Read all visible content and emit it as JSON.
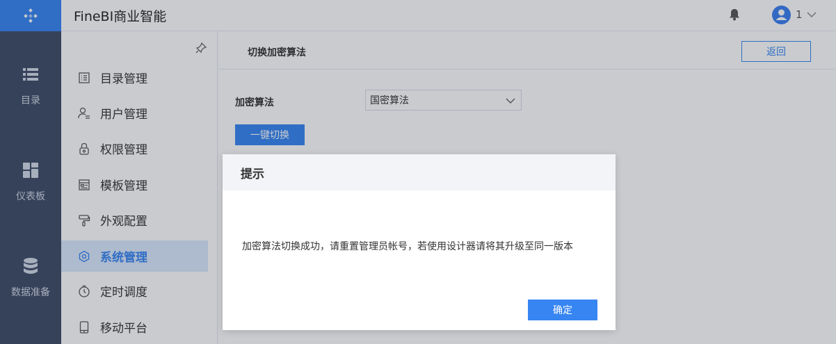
{
  "app": {
    "title": "FineBI商业智能"
  },
  "header": {
    "user_name": "1"
  },
  "leftnav": {
    "items": [
      {
        "label": "目录",
        "icon": "list-icon"
      },
      {
        "label": "仪表板",
        "icon": "dashboard-icon"
      },
      {
        "label": "数据准备",
        "icon": "database-icon"
      }
    ]
  },
  "submenu": {
    "items": [
      {
        "label": "目录管理",
        "icon": "catalog-icon"
      },
      {
        "label": "用户管理",
        "icon": "user-manage-icon"
      },
      {
        "label": "权限管理",
        "icon": "lock-icon"
      },
      {
        "label": "模板管理",
        "icon": "template-icon"
      },
      {
        "label": "外观配置",
        "icon": "brush-icon"
      },
      {
        "label": "系统管理",
        "icon": "gear-icon",
        "active": true
      },
      {
        "label": "定时调度",
        "icon": "timer-icon"
      },
      {
        "label": "移动平台",
        "icon": "mobile-icon"
      }
    ]
  },
  "main": {
    "title": "切换加密算法",
    "back_label": "返回",
    "form_label": "加密算法",
    "select_value": "国密算法",
    "switch_label": "一键切换"
  },
  "dialog": {
    "title": "提示",
    "message": "加密算法切换成功，请重置管理员帐号，若使用设计器请将其升级至同一版本",
    "ok_label": "确定"
  },
  "colors": {
    "accent": "#3685f2",
    "nav_bg": "#3e4b66",
    "active_bg": "#dce9fd"
  }
}
